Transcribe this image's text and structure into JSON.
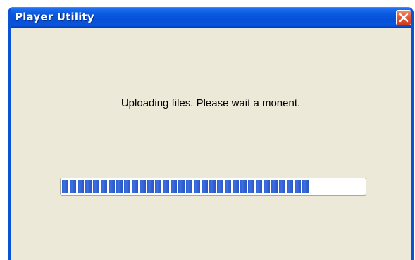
{
  "window": {
    "title": "Player Utility",
    "close_icon": "close-x-icon"
  },
  "dialog": {
    "message": "Uploading files. Please wait a monent.",
    "progress_fraction": 0.82
  },
  "colors": {
    "titlebar": "#0a58e0",
    "body": "#ece9d8",
    "progress": "#2f5fd0",
    "close": "#e2583c"
  }
}
